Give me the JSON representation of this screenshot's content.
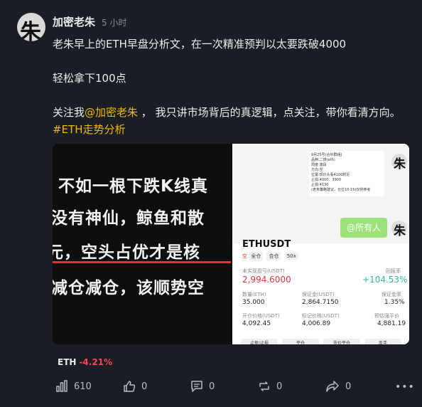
{
  "post": {
    "author": "加密老朱",
    "avatar_char": "朱",
    "time": "5 小时",
    "line1": "老朱早上的ETH早盘分析文，在一次精准预判以太要跌破4000",
    "line2": "轻松拿下100点",
    "line3_pre": "关注我",
    "mention": "@加密老朱",
    "line3_mid": " ，  我只讲市场背后的真逻辑，点关注，带你看清方向。",
    "hashtag": "#ETH走势分析"
  },
  "media": {
    "image1_lines": [
      "不如一根下跌K线真",
      "没有神仙，鲸鱼和散",
      "元，空头占优才是核",
      "减仓减仓，该顺势空"
    ],
    "chat_bubble_lines": [
      "9月25号(合伙群组)",
      "品种:二饼(eth)",
      "周度:波段",
      "方向:空",
      "位置:现价头看4100附近",
      "止损:4000、3900",
      "止损:4130",
      "(老朱策略建议，仓位10-15)仅供参考"
    ],
    "chat_reply": "@所有人",
    "trade": {
      "symbol": "ETHUSDT",
      "side": "空",
      "mode1": "全仓",
      "mode2": "合仓",
      "leverage": "50x",
      "unrealized_label": "未实现盈亏(USDT)",
      "unrealized_value": "2,994.6000",
      "roi_label": "回报率",
      "roi_value": "+104.53%",
      "qty_label": "数量(ETH)",
      "qty_value": "35.000",
      "margin_label": "保证金(USDT)",
      "margin_value": "2,864.7150",
      "margin_ratio_label": "保证金率",
      "margin_ratio_value": "1.35%",
      "entry_label": "开仓价格(USDT)",
      "entry_value": "4,092.45",
      "mark_label": "标记价格(USDT)",
      "mark_value": "4,006.89",
      "liq_label": "预估强平价",
      "liq_value": "4,881.19",
      "buttons": [
        "止盈/止损",
        "平仓",
        "市价平仓",
        "反手"
      ]
    }
  },
  "coin": {
    "symbol": "ETH",
    "change": "-4.21%"
  },
  "actions": {
    "views": "610",
    "likes": "0",
    "comments": "0",
    "reposts": "0",
    "shares": "0"
  },
  "colors": {
    "accent": "#f0b90b",
    "down": "#f6465d",
    "background": "#1a1d23"
  }
}
